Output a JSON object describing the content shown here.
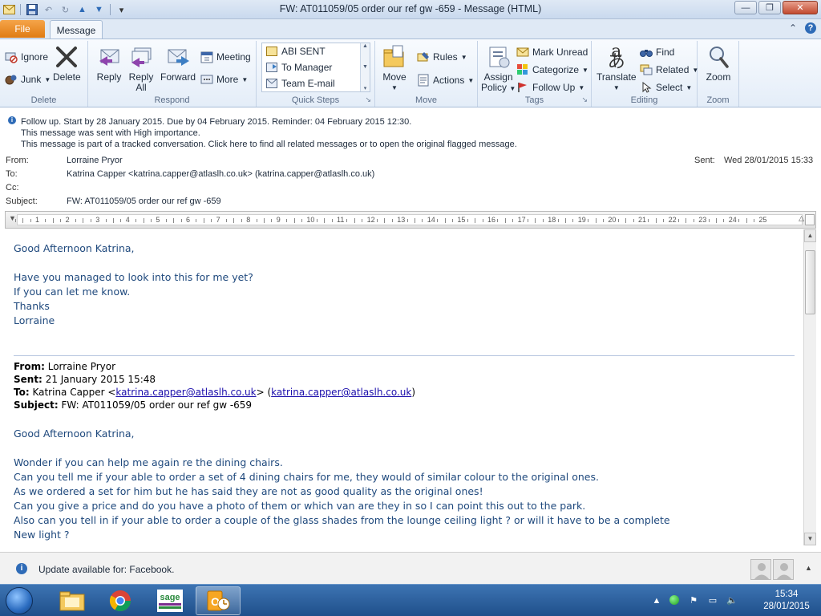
{
  "window": {
    "title": "FW: AT011059/05 order our ref  gw -659  -  Message (HTML)"
  },
  "tabs": {
    "file": "File",
    "message": "Message"
  },
  "ribbon": {
    "delete_group": {
      "label": "Delete",
      "ignore": "Ignore",
      "junk": "Junk",
      "delete": "Delete"
    },
    "respond_group": {
      "label": "Respond",
      "reply": "Reply",
      "reply_all_1": "Reply",
      "reply_all_2": "All",
      "forward": "Forward",
      "meeting": "Meeting",
      "more": "More"
    },
    "quick_steps": {
      "label": "Quick Steps",
      "items": [
        "ABI SENT",
        "To Manager",
        "Team E-mail"
      ]
    },
    "move_group": {
      "label": "Move",
      "move": "Move",
      "rules": "Rules",
      "actions": "Actions"
    },
    "tags_group": {
      "label": "Tags",
      "assign_1": "Assign",
      "assign_2": "Policy",
      "mark_unread": "Mark Unread",
      "categorize": "Categorize",
      "follow_up": "Follow Up"
    },
    "editing_group": {
      "label": "Editing",
      "translate": "Translate",
      "find": "Find",
      "related": "Related",
      "select": "Select"
    },
    "zoom_group": {
      "label": "Zoom",
      "zoom": "Zoom"
    }
  },
  "info": {
    "line1": "Follow up.  Start by 28 January 2015.  Due by 04 February 2015.  Reminder: 04 February 2015 12:30.",
    "line2": "This message was sent with High importance.",
    "line3": "This message is part of a tracked conversation. Click here to find all related messages or to open the original flagged message."
  },
  "headers": {
    "from_label": "From:",
    "from": "Lorraine Pryor",
    "to_label": "To:",
    "to": "Katrina Capper <katrina.capper@atlaslh.co.uk> (katrina.capper@atlaslh.co.uk)",
    "cc_label": "Cc:",
    "subject_label": "Subject:",
    "subject": "FW: AT011059/05 order our ref  gw -659",
    "sent_label": "Sent:",
    "sent": "Wed 28/01/2015 15:33"
  },
  "ruler": [
    "1",
    "2",
    "3",
    "4",
    "5",
    "6",
    "7",
    "8",
    "9",
    "10",
    "11",
    "12",
    "13",
    "14",
    "15",
    "16",
    "17",
    "18",
    "19",
    "20",
    "21",
    "22",
    "23",
    "24",
    "25"
  ],
  "body": {
    "greeting": "Good Afternoon Katrina,",
    "lines": [
      "Have you managed to look into this for me yet?",
      "If you can let me know.",
      "Thanks",
      "Lorraine"
    ]
  },
  "forwarded": {
    "from_label": "From:",
    "from": "Lorraine Pryor",
    "sent_label": "Sent:",
    "sent": "21 January 2015 15:48",
    "to_label": "To:",
    "to_name": "Katrina Capper <",
    "to_email": "katrina.capper@atlaslh.co.uk",
    "to_mid": "> (",
    "to_email2": "katrina.capper@atlaslh.co.uk",
    "to_end": ")",
    "subject_label": "Subject:",
    "subject": "FW: AT011059/05 order our ref gw -659",
    "greeting": "Good Afternoon Katrina,",
    "lines": [
      "Wonder if you can help me again re the dining chairs.",
      "Can you tell me if your able to order a set of 4 dining chairs for me, they would of similar colour to the original ones.",
      "As we ordered a set for him but he has said they are not as good quality as the original ones!",
      "Can you give a price and do you have a photo of them or which van are they in so I can point this out to the park.",
      "Also can you tell in if your able to order a couple of the glass shades from the lounge ceiling light ? or will it have to be a complete",
      "New light ?"
    ]
  },
  "people_pane": {
    "text": "Update available for: Facebook."
  },
  "taskbar": {
    "time": "15:34",
    "date": "28/01/2015",
    "sage_label": "sage"
  }
}
